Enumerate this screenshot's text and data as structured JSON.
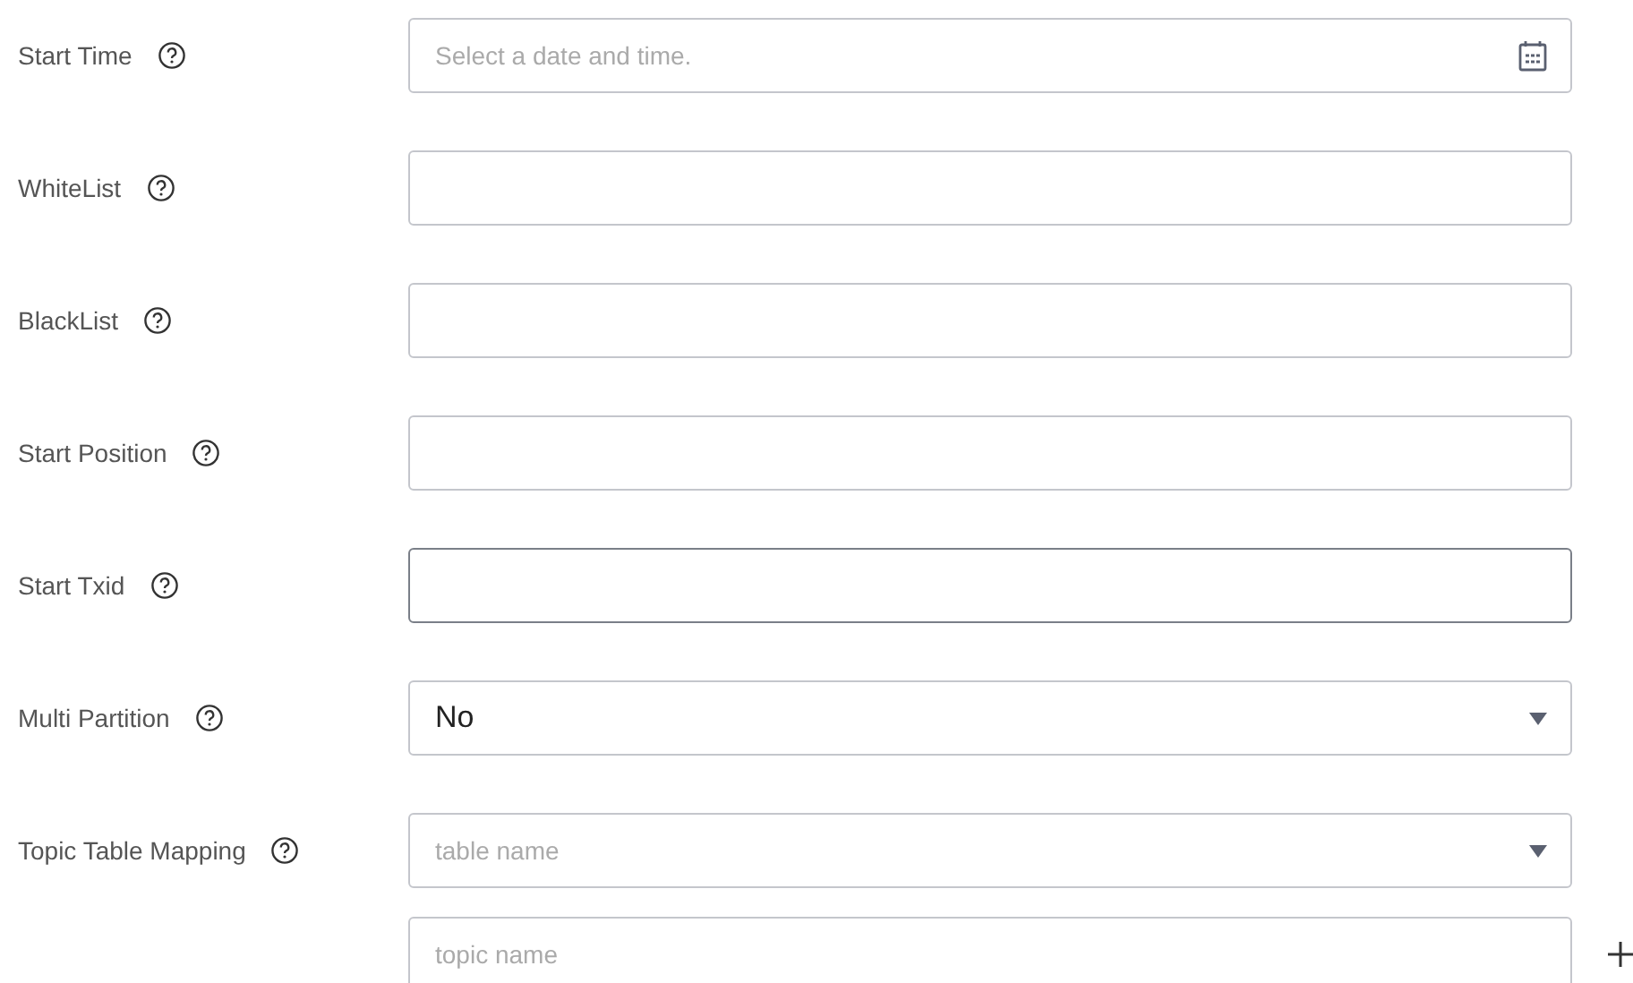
{
  "rows": [
    {
      "label": "Start Time",
      "fields": [
        {
          "kind": "date",
          "placeholder": "Select a date and time."
        }
      ]
    },
    {
      "label": "WhiteList",
      "fields": [
        {
          "kind": "text"
        }
      ]
    },
    {
      "label": "BlackList",
      "fields": [
        {
          "kind": "text"
        }
      ]
    },
    {
      "label": "Start Position",
      "fields": [
        {
          "kind": "text"
        }
      ]
    },
    {
      "label": "Start Txid",
      "fields": [
        {
          "kind": "text",
          "focused": true
        }
      ]
    },
    {
      "label": "Multi Partition",
      "fields": [
        {
          "kind": "select",
          "value": "No"
        }
      ]
    },
    {
      "label": "Topic Table Mapping",
      "fields": [
        {
          "kind": "select",
          "placeholder": "table name"
        },
        {
          "kind": "text",
          "placeholder": "topic name",
          "addable": true
        }
      ]
    }
  ]
}
